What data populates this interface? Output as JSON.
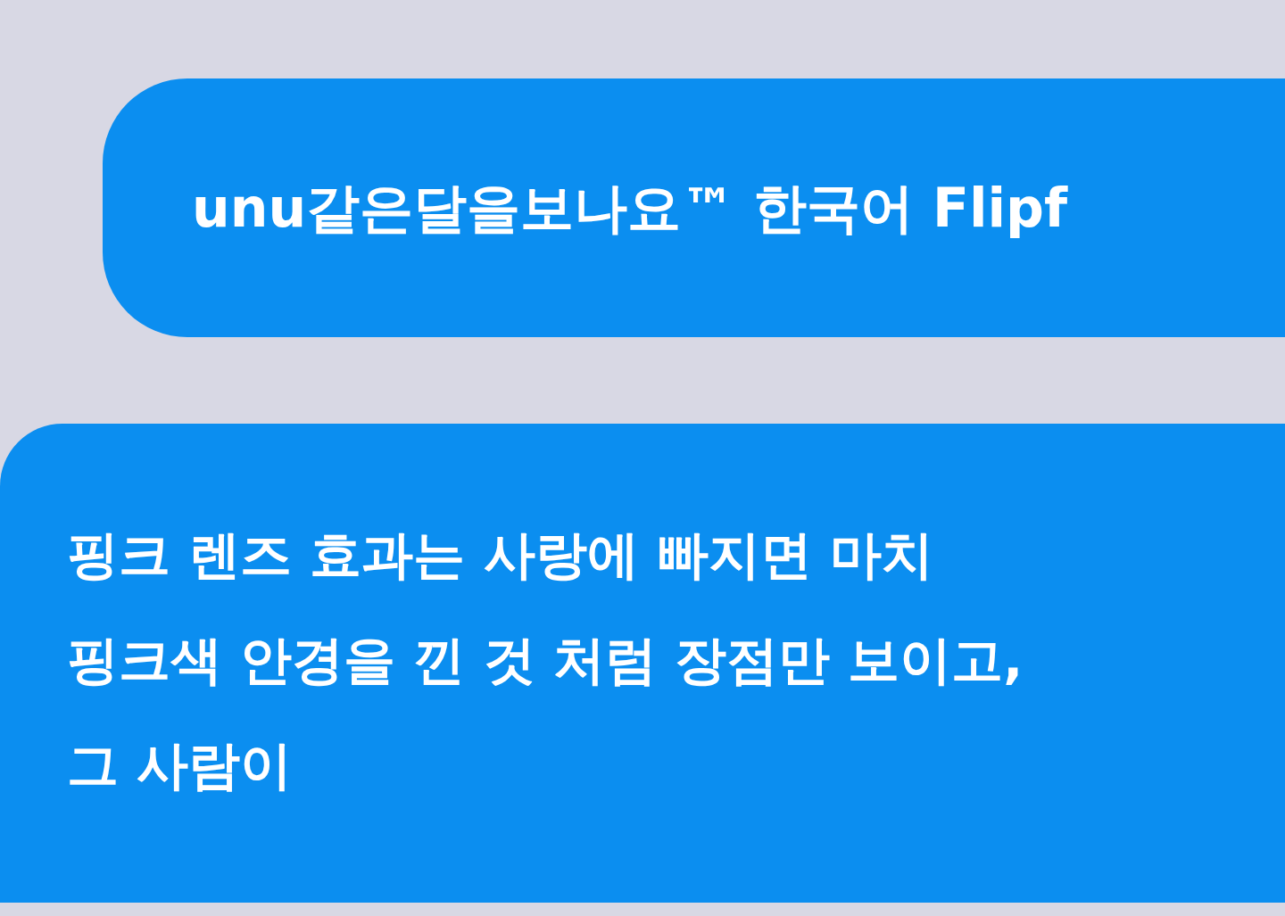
{
  "messages": [
    {
      "text": "unu같은달을보나요™ 한국어 Flipf",
      "kind": "short"
    },
    {
      "text": "핑크 렌즈 효과는 사랑에 빠지면 마치\n핑크색 안경을 낀 것 처럼 장점만 보이고,\n그 사람이",
      "kind": "long"
    }
  ]
}
